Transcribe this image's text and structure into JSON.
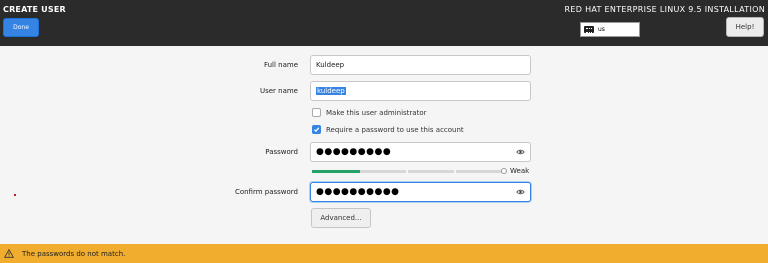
{
  "header": {
    "screen_title": "CREATE USER",
    "done_label": "Done",
    "product_title": "RED HAT ENTERPRISE LINUX 9.5 INSTALLATION",
    "keyboard_layout": "us",
    "help_label": "Help!"
  },
  "form": {
    "full_name_label": "Full name",
    "full_name_value": "Kuldeep",
    "user_name_label": "User name",
    "user_name_value": "kuldeep",
    "admin_checkbox_label": "Make this user administrator",
    "admin_checked": false,
    "require_password_label": "Require a password to use this account",
    "require_password_checked": true,
    "password_label": "Password",
    "password_value": "●●●●●●●●●",
    "strength_label": "Weak",
    "strength_level": 0.25,
    "confirm_label": "Confirm password",
    "confirm_value": "●●●●●●●●●●",
    "advanced_label": "Advanced..."
  },
  "status": {
    "message": "The passwords do not match."
  },
  "colors": {
    "accent": "#3584e4",
    "warning_bar": "#f0ad2e",
    "strength_fill": "#26a269",
    "header_bg": "#2b2b2b"
  },
  "icons": [
    "keyboard-icon",
    "eye-icon",
    "warning-icon",
    "checkmark-icon"
  ]
}
